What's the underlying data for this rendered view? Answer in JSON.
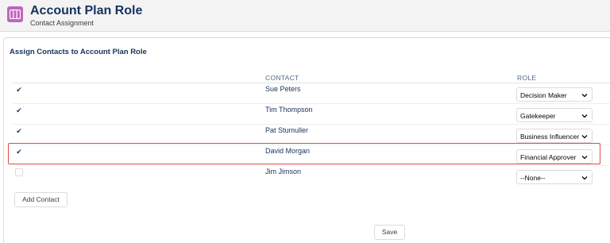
{
  "header": {
    "title": "Account Plan Role",
    "subtitle": "Contact Assignment",
    "icon": "account-plan-icon",
    "icon_color": "#c065c0"
  },
  "section": {
    "title": "Assign Contacts to Account Plan Role"
  },
  "table": {
    "columns": [
      "CONTACT",
      "ROLE"
    ],
    "rows": [
      {
        "checked": true,
        "contact": "Sue Peters",
        "role": "Decision Maker",
        "highlighted": false
      },
      {
        "checked": true,
        "contact": "Tim Thompson",
        "role": "Gatekeeper",
        "highlighted": false
      },
      {
        "checked": true,
        "contact": "Pat Stumuller",
        "role": "Business Influencer",
        "highlighted": false
      },
      {
        "checked": true,
        "contact": "David Morgan",
        "role": "Financial Approver",
        "highlighted": true
      },
      {
        "checked": false,
        "contact": "Jim Jimson",
        "role": "--None--",
        "highlighted": false
      }
    ]
  },
  "buttons": {
    "add_contact": "Add Contact",
    "save": "Save"
  },
  "colors": {
    "highlight_border": "#e04a4a",
    "text_primary": "#16325c"
  }
}
